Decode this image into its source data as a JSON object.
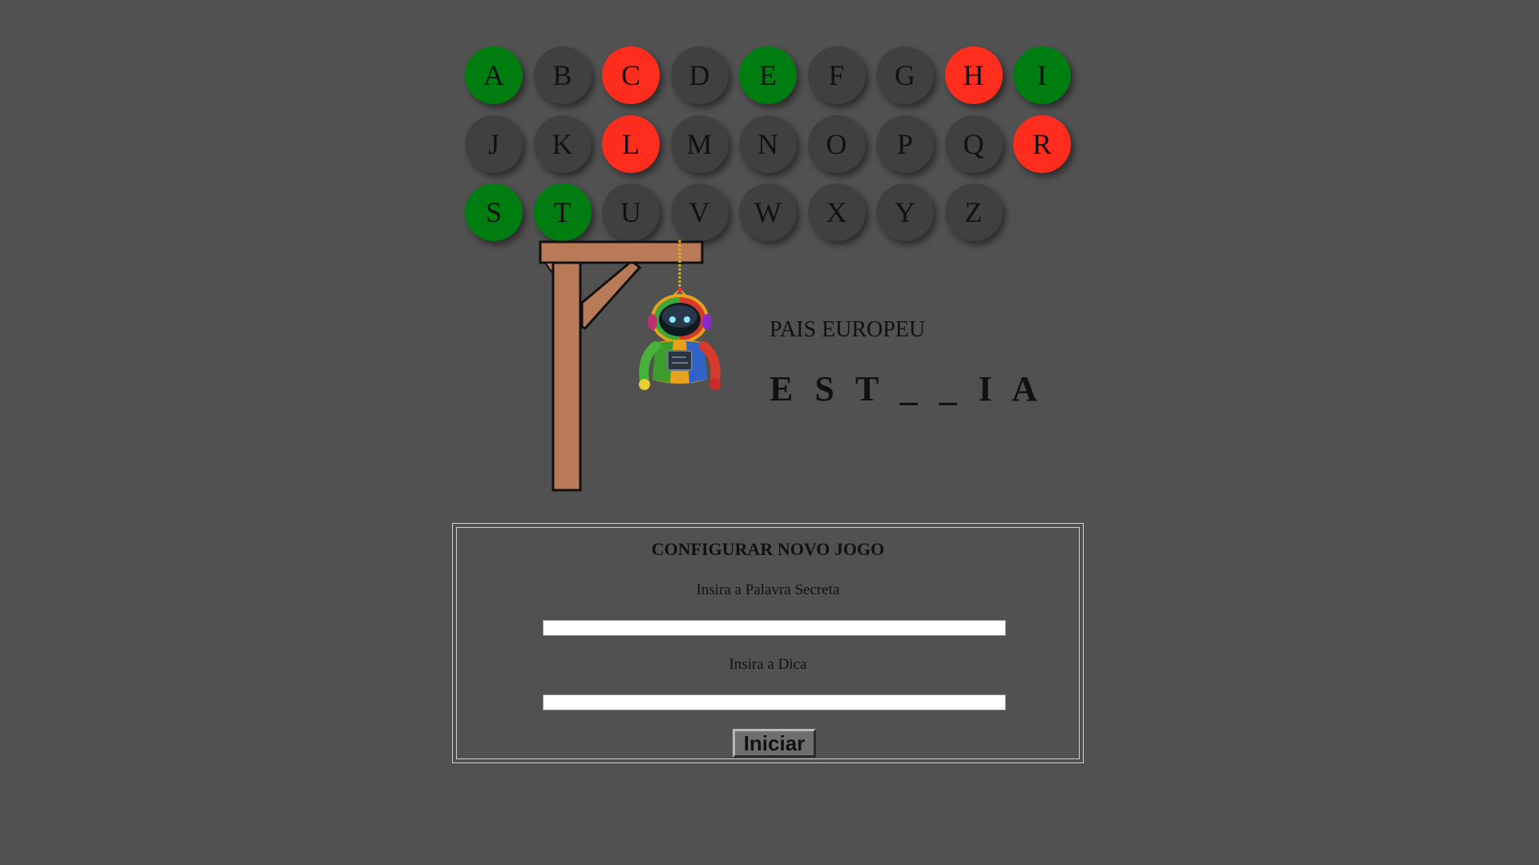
{
  "keyboard": {
    "rows": [
      [
        {
          "letter": "A",
          "state": "correct"
        },
        {
          "letter": "B",
          "state": "unused"
        },
        {
          "letter": "C",
          "state": "wrong"
        },
        {
          "letter": "D",
          "state": "unused"
        },
        {
          "letter": "E",
          "state": "correct"
        },
        {
          "letter": "F",
          "state": "unused"
        },
        {
          "letter": "G",
          "state": "unused"
        },
        {
          "letter": "H",
          "state": "wrong"
        },
        {
          "letter": "I",
          "state": "correct"
        }
      ],
      [
        {
          "letter": "J",
          "state": "unused"
        },
        {
          "letter": "K",
          "state": "unused"
        },
        {
          "letter": "L",
          "state": "wrong"
        },
        {
          "letter": "M",
          "state": "unused"
        },
        {
          "letter": "N",
          "state": "unused"
        },
        {
          "letter": "O",
          "state": "unused"
        },
        {
          "letter": "P",
          "state": "unused"
        },
        {
          "letter": "Q",
          "state": "unused"
        },
        {
          "letter": "R",
          "state": "wrong"
        }
      ],
      [
        {
          "letter": "S",
          "state": "correct"
        },
        {
          "letter": "T",
          "state": "correct"
        },
        {
          "letter": "U",
          "state": "unused"
        },
        {
          "letter": "V",
          "state": "unused"
        },
        {
          "letter": "W",
          "state": "unused"
        },
        {
          "letter": "X",
          "state": "unused"
        },
        {
          "letter": "Y",
          "state": "unused"
        },
        {
          "letter": "Z",
          "state": "unused"
        }
      ]
    ],
    "colors": {
      "correct": "#007d11",
      "wrong": "#ff2d1e",
      "unused": "#404040"
    }
  },
  "game": {
    "hint": "PAIS EUROPEU",
    "word_display": "E S T _ _ I A",
    "character_icon": "robot-icon"
  },
  "config": {
    "title": "CONFIGURAR NOVO JOGO",
    "secret_word_label": "Insira a Palavra Secreta",
    "secret_word_value": "",
    "hint_label": "Insira a Dica",
    "hint_value": "",
    "start_button": "Iniciar"
  },
  "theme": {
    "background": "#515151",
    "wood": "#b97a57"
  }
}
